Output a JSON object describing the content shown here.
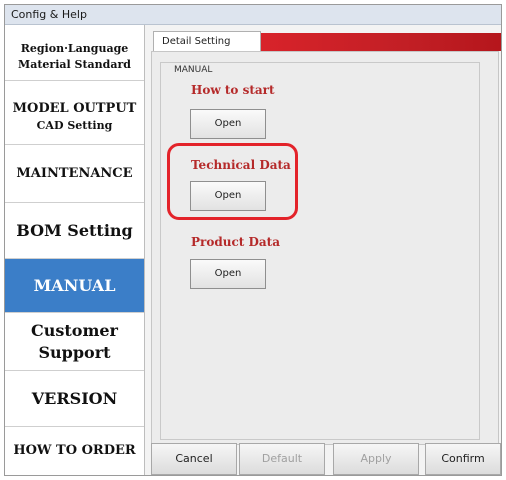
{
  "window": {
    "title": "Config & Help"
  },
  "sidebar": {
    "items": [
      {
        "lines": [
          "Region·Language",
          "Material Standard"
        ]
      },
      {
        "lines": [
          "MODEL OUTPUT",
          "CAD Setting"
        ]
      },
      {
        "lines": [
          "MAINTENANCE"
        ]
      },
      {
        "lines": [
          "BOM Setting"
        ]
      },
      {
        "lines": [
          "MANUAL"
        ],
        "active": true
      },
      {
        "lines": [
          "Customer",
          "Support"
        ]
      },
      {
        "lines": [
          "VERSION"
        ]
      },
      {
        "lines": [
          "HOW TO ORDER"
        ]
      }
    ]
  },
  "tabs": {
    "active": "Detail Setting"
  },
  "manual": {
    "legend": "MANUAL",
    "sections": [
      {
        "title": "How to start",
        "button": "Open"
      },
      {
        "title": "Technical Data",
        "button": "Open",
        "highlighted": true
      },
      {
        "title": "Product Data",
        "button": "Open"
      }
    ]
  },
  "footer": {
    "cancel": "Cancel",
    "default": "Default",
    "apply": "Apply",
    "confirm": "Confirm"
  },
  "colors": {
    "accent": "#3b7ec8",
    "section_title": "#b52a2a",
    "highlight": "#e3232a",
    "tab_strip": "#c21f25"
  }
}
